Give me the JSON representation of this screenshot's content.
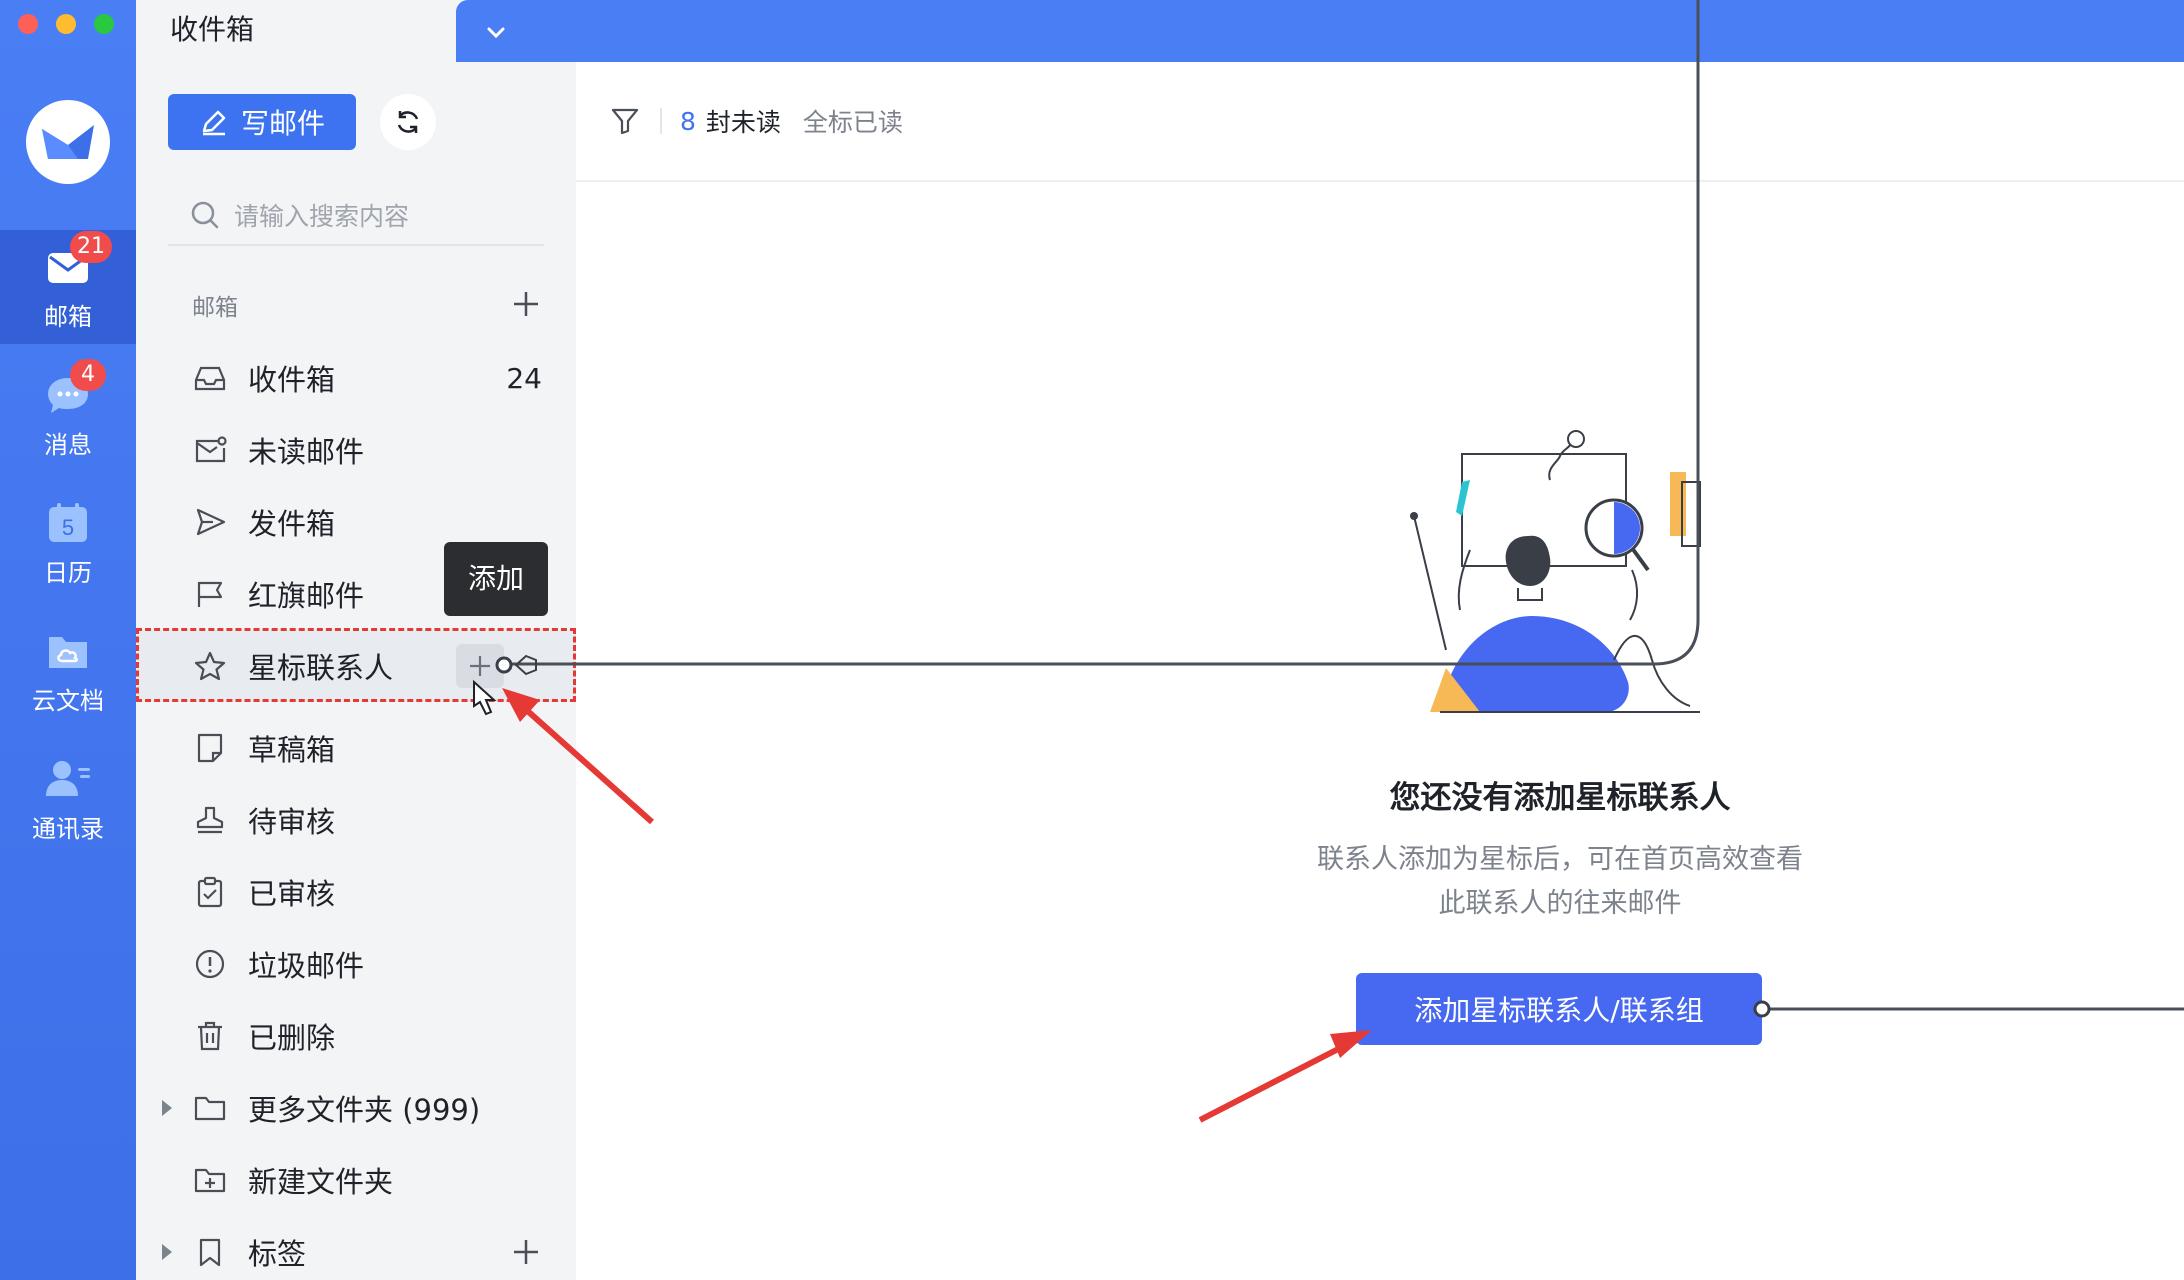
{
  "rail": {
    "items": [
      {
        "label": "邮箱",
        "badge": "21",
        "icon": "mail-icon"
      },
      {
        "label": "消息",
        "badge": "4",
        "icon": "chat-icon"
      },
      {
        "label": "日历",
        "badge": "",
        "icon": "calendar-icon",
        "calendar_day": "5"
      },
      {
        "label": "云文档",
        "badge": "",
        "icon": "cloud-doc-icon"
      },
      {
        "label": "通讯录",
        "badge": "",
        "icon": "contacts-icon"
      }
    ]
  },
  "header": {
    "active_tab": "收件箱"
  },
  "toolbar": {
    "compose_label": "写邮件"
  },
  "search": {
    "placeholder": "请输入搜索内容"
  },
  "sidebar": {
    "section_label": "邮箱",
    "folders": [
      {
        "label": "收件箱",
        "count": "24",
        "icon": "inbox-icon"
      },
      {
        "label": "未读邮件",
        "count": "",
        "icon": "unread-mail-icon"
      },
      {
        "label": "发件箱",
        "count": "",
        "icon": "send-icon"
      },
      {
        "label": "红旗邮件",
        "count": "",
        "icon": "flag-icon"
      },
      {
        "label": "星标联系人",
        "count": "",
        "icon": "star-icon"
      },
      {
        "label": "草稿箱",
        "count": "",
        "icon": "draft-icon"
      },
      {
        "label": "待审核",
        "count": "",
        "icon": "stamp-icon"
      },
      {
        "label": "已审核",
        "count": "",
        "icon": "clipboard-check-icon"
      },
      {
        "label": "垃圾邮件",
        "count": "",
        "icon": "spam-icon"
      },
      {
        "label": "已删除",
        "count": "",
        "icon": "trash-icon"
      },
      {
        "label": "更多文件夹 (999)",
        "count": "",
        "icon": "folder-icon"
      },
      {
        "label": "新建文件夹",
        "count": "",
        "icon": "new-folder-icon"
      },
      {
        "label": "标签",
        "count": "",
        "icon": "tag-icon"
      }
    ],
    "tooltip": "添加"
  },
  "filterbar": {
    "unread_count": "8",
    "unread_text": "封未读",
    "mark_all_read": "全标已读"
  },
  "empty_state": {
    "title": "您还没有添加星标联系人",
    "desc_line1": "联系人添加为星标后，可在首页高效查看",
    "desc_line2": "此联系人的往来邮件",
    "button_label": "添加星标联系人/联系组"
  },
  "colors": {
    "brand": "#4a7ef5",
    "primary_button": "#4768f0",
    "badge": "#f04c4c",
    "annotation": "#e53935"
  }
}
